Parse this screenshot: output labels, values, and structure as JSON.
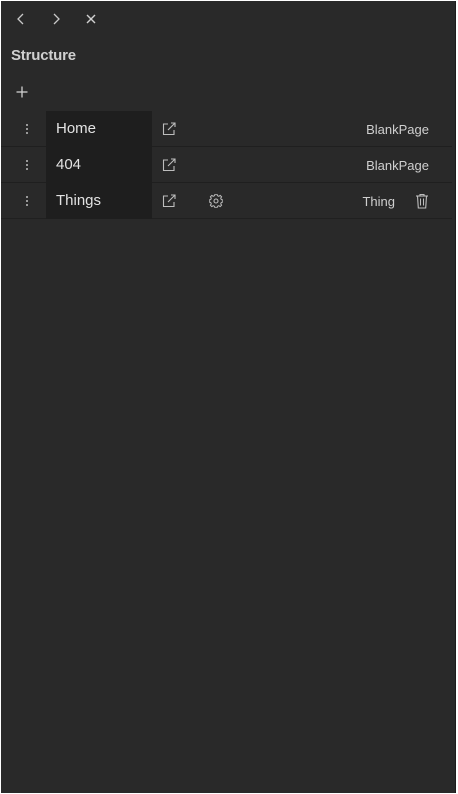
{
  "toolbar": {
    "back_icon": "chevron-left-icon",
    "forward_icon": "chevron-right-icon",
    "close_icon": "close-icon"
  },
  "panel": {
    "title": "Structure",
    "add_icon": "plus-icon"
  },
  "rows": [
    {
      "name": "Home",
      "type": "BlankPage",
      "has_settings": false,
      "has_delete": false
    },
    {
      "name": "404",
      "type": "BlankPage",
      "has_settings": false,
      "has_delete": false
    },
    {
      "name": "Things",
      "type": "Thing",
      "has_settings": true,
      "has_delete": true
    }
  ],
  "colors": {
    "panel_bg": "#292929",
    "name_cell_bg": "#1e1e1e",
    "text": "#d6d6d6",
    "icon": "#bdbdbd"
  }
}
